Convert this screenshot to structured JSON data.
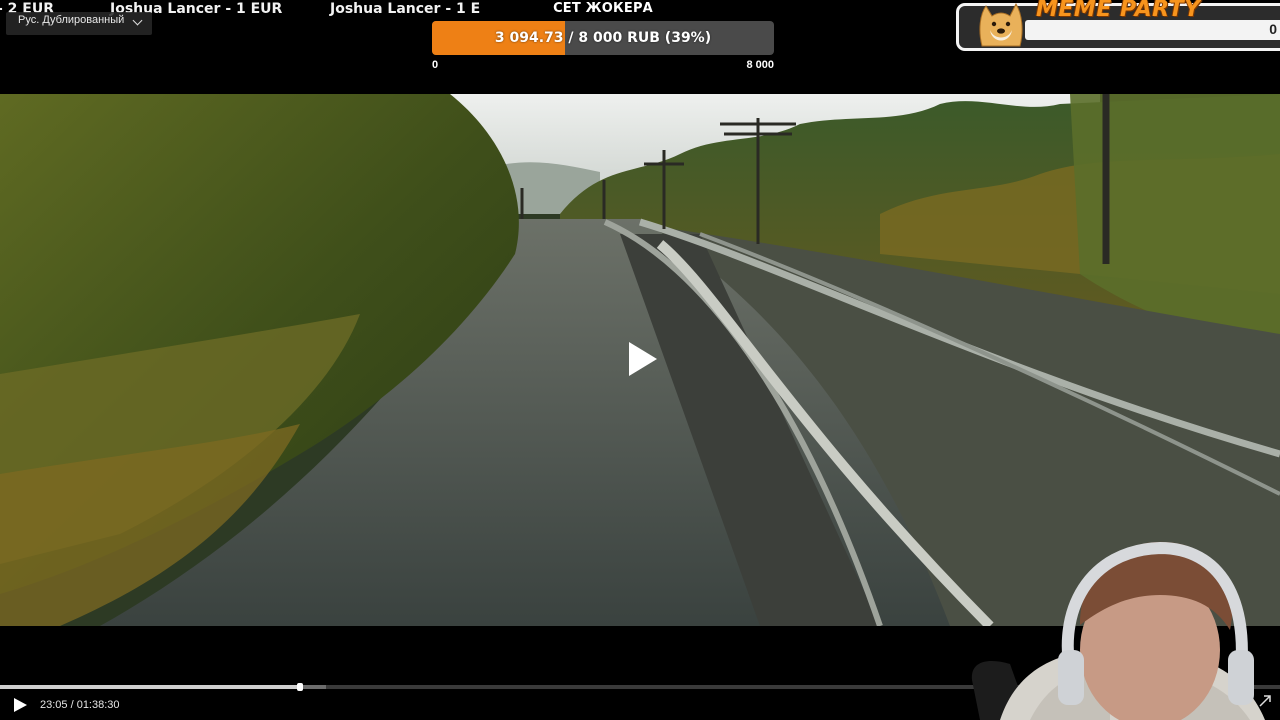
{
  "ticker": {
    "items": [
      "- 2 EUR",
      "Joshua Lancer - 1 EUR",
      "Joshua Lancer - 1 E"
    ]
  },
  "audio_track": {
    "selected": "Рус. Дублированный",
    "icon": "chevron-down-icon"
  },
  "donation_goal": {
    "title": "СЕТ ЖОКЕРА",
    "progress_text": "3 094.73 / 8 000 RUB (39%)",
    "current": 3094.73,
    "target": 8000,
    "percent": 39,
    "min_label": "0",
    "max_label": "8 000",
    "colors": {
      "fill": "#ee8015",
      "track": "#4a4a4a"
    }
  },
  "meme_widget": {
    "title": "MEME PARTY",
    "value": "0",
    "icon": "doge-icon",
    "colors": {
      "title": "#f7941d"
    }
  },
  "player": {
    "center_icon": "play-icon",
    "time": "23:05 / 01:38:30",
    "played_fraction": 0.234,
    "buffered_fraction": 0.255,
    "play_icon": "play-icon",
    "fullscreen_icon": "expand-icon"
  },
  "webcam": {
    "icon": "webcam-feed"
  }
}
